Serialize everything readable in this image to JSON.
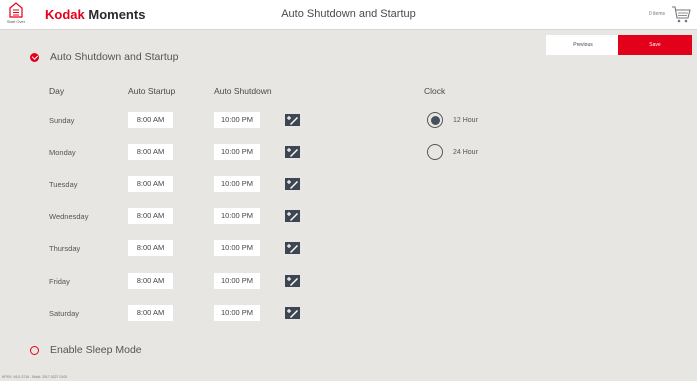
{
  "header": {
    "start_over_label": "Start Over",
    "brand_kodak": "Kodak",
    "brand_moments": "Moments",
    "page_title": "Auto Shutdown and Startup",
    "cart_count": "0 items",
    "brand_color": "#e3001b"
  },
  "actions": {
    "previous_label": "Previous",
    "save_label": "Save"
  },
  "auto_section": {
    "label": "Auto Shutdown and Startup",
    "enabled": true
  },
  "schedule": {
    "col_day": "Day",
    "col_startup": "Auto Startup",
    "col_shutdown": "Auto Shutdown",
    "rows": [
      {
        "day": "Sunday",
        "startup": "8:00 AM",
        "shutdown": "10:00 PM"
      },
      {
        "day": "Monday",
        "startup": "8:00 AM",
        "shutdown": "10:00 PM"
      },
      {
        "day": "Tuesday",
        "startup": "8:00 AM",
        "shutdown": "10:00 PM"
      },
      {
        "day": "Wednesday",
        "startup": "8:00 AM",
        "shutdown": "10:00 PM"
      },
      {
        "day": "Thursday",
        "startup": "8:00 AM",
        "shutdown": "10:00 PM"
      },
      {
        "day": "Friday",
        "startup": "8:00 AM",
        "shutdown": "10:00 PM"
      },
      {
        "day": "Saturday",
        "startup": "8:00 AM",
        "shutdown": "10:00 PM"
      }
    ],
    "row_icon": "copy-to-all-icon"
  },
  "clock": {
    "label": "Clock",
    "options": [
      {
        "label": "12 Hour",
        "selected": true
      },
      {
        "label": "24 Hour",
        "selected": false
      }
    ]
  },
  "sleep_section": {
    "label": "Enable Sleep Mode",
    "enabled": false
  },
  "footer": {
    "version": "KPSV: V6.0.3716 - Build: 2017.0327.0100"
  }
}
